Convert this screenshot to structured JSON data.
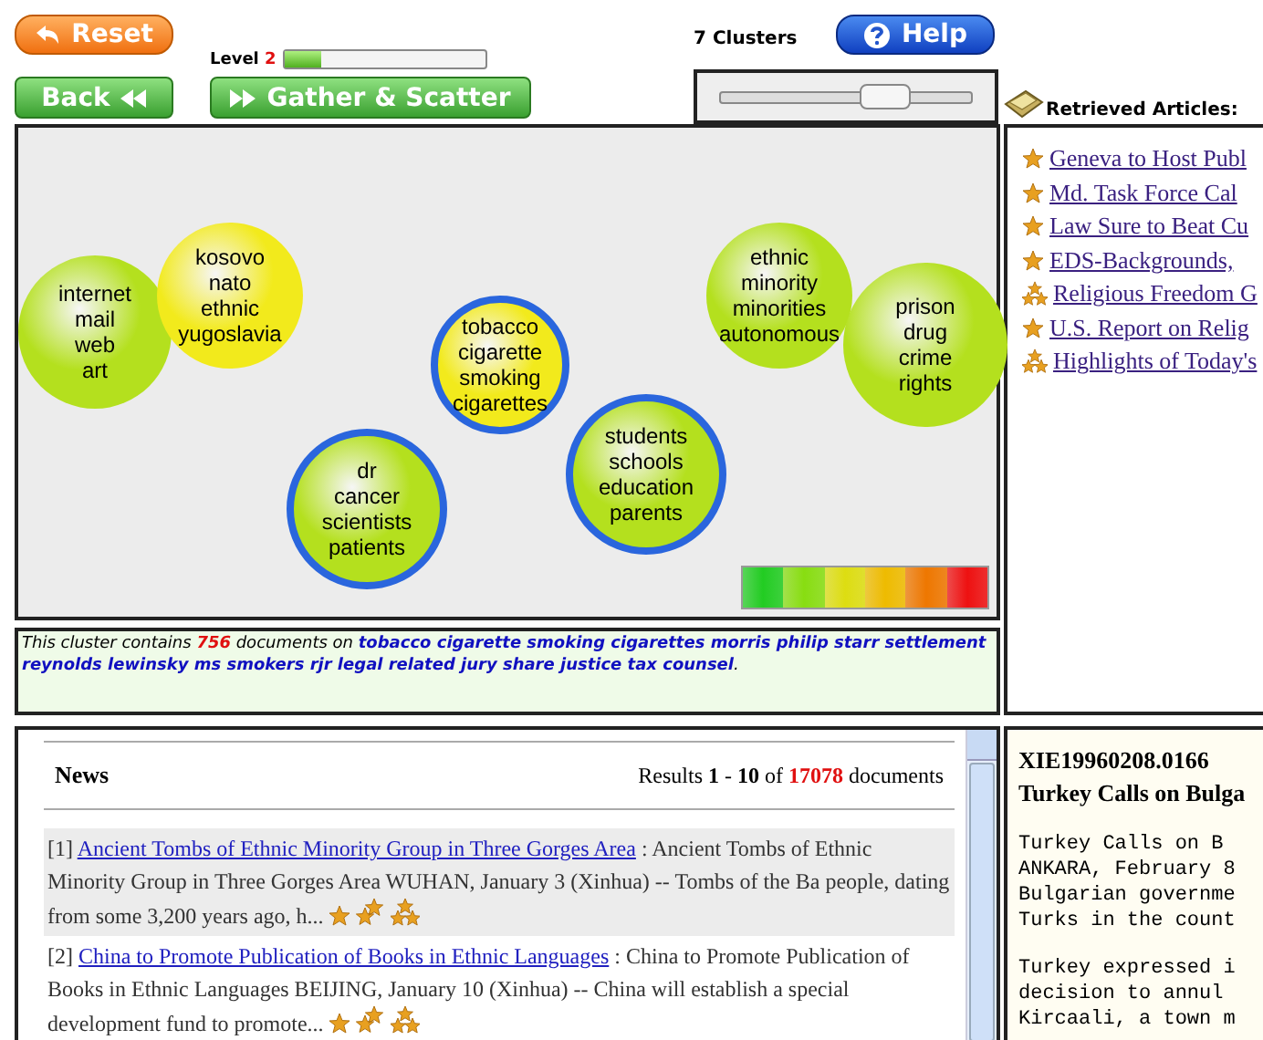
{
  "toolbar": {
    "reset": "Reset",
    "level_label": "Level",
    "level_value": "2",
    "level": 0.18,
    "back": "Back",
    "gather": "Gather & Scatter",
    "clusters": "7 Clusters",
    "help": "Help",
    "slider": {
      "level": 0.66
    }
  },
  "clusters": [
    {
      "terms": [
        "internet",
        "mail",
        "web",
        "art"
      ],
      "color": "#b4e01e",
      "selected": false
    },
    {
      "terms": [
        "kosovo",
        "nato",
        "ethnic",
        "yugoslavia"
      ],
      "color": "#f2ea1c",
      "selected": false
    },
    {
      "terms": [
        "tobacco",
        "cigarette",
        "smoking",
        "cigarettes"
      ],
      "color": "#f2ea1c",
      "selected": true
    },
    {
      "terms": [
        "dr",
        "cancer",
        "scientists",
        "patients"
      ],
      "color": "#b4e01e",
      "selected": true
    },
    {
      "terms": [
        "students",
        "schools",
        "education",
        "parents"
      ],
      "color": "#b4e01e",
      "selected": true
    },
    {
      "terms": [
        "ethnic",
        "minority",
        "minorities",
        "autonomous"
      ],
      "color": "#b4e01e",
      "selected": false
    },
    {
      "terms": [
        "prison",
        "drug",
        "crime",
        "rights"
      ],
      "color": "#b4e01e",
      "selected": false
    }
  ],
  "cluster_info": "This cluster contains **756** documents on **tobacco cigarette smoking cigarettes morris philip starr settlement reynolds lewinsky ms smokers rjr legal related jury share justice tax counsel**.",
  "news": {
    "title": "News",
    "results": "Results **1** - **10** of **17078** documents",
    "items": [
      {
        "index": "[1]",
        "title": "Ancient Tombs of Ethnic Minority Group in Three Gorges Area",
        "snippet": ": Ancient Tombs of Ethnic Minority Group in Three Gorges Area WUHAN, January 3 (Xinhua) -- Tombs of the Ba people, dating from some 3,200 years ago, h...",
        "selected": true
      },
      {
        "index": "[2]",
        "title": "China to Promote Publication of Books in Ethnic Languages",
        "snippet": ": China to Promote Publication of Books in Ethnic Languages BEIJING, January 10 (Xinhua) -- China will establish a special development fund to promote...",
        "selected": false
      }
    ]
  },
  "articles": {
    "title": "Retrieved Articles:",
    "items": [
      {
        "kind": "star",
        "title": "Geneva to Host Publ"
      },
      {
        "kind": "star",
        "title": "Md. Task Force Cal"
      },
      {
        "kind": "star",
        "title": "Law Sure to Beat Cu"
      },
      {
        "kind": "star",
        "title": "EDS-Backgrounds,"
      },
      {
        "kind": "stars",
        "title": "Religious Freedom G"
      },
      {
        "kind": "star",
        "title": "U.S. Report on Relig"
      },
      {
        "kind": "stars",
        "title": "Highlights of Today's"
      }
    ]
  },
  "document": {
    "id": "XIE19960208.0166",
    "title": "Turkey Calls on Bulga",
    "paragraphs": [
      [
        "Turkey Calls on B",
        "ANKARA, February 8",
        "Bulgarian governme",
        "Turks in the count"
      ],
      [
        "Turkey expressed i",
        "decision to annul",
        "Kircaali, a town m"
      ]
    ]
  }
}
